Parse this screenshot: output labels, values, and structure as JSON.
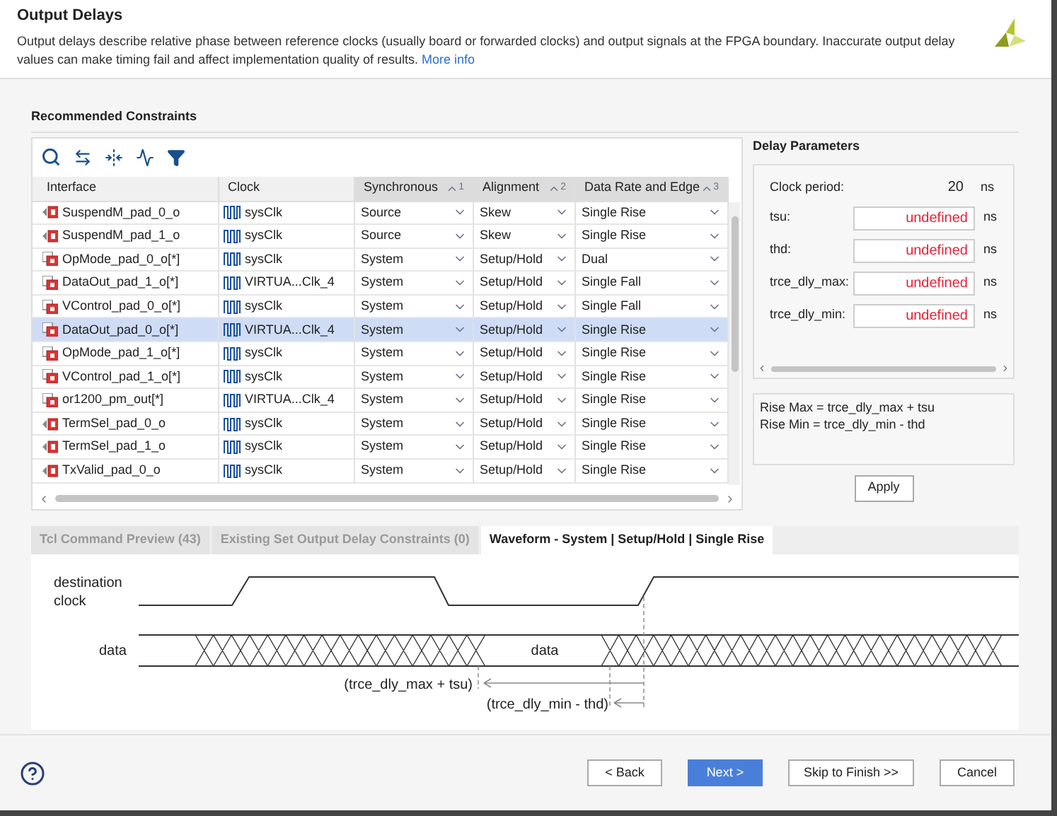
{
  "header": {
    "title": "Output Delays",
    "description": "Output delays describe relative phase between reference clocks (usually board or forwarded clocks) and output signals at the FPGA boundary. Inaccurate output delay values can make timing fail and affect implementation quality of results.",
    "link": "More info"
  },
  "constraints": {
    "title": "Recommended Constraints",
    "columns": [
      {
        "label": "Interface",
        "sorted": false
      },
      {
        "label": "Clock",
        "sorted": false
      },
      {
        "label": "Synchronous",
        "sorted": true,
        "sort_order": "1"
      },
      {
        "label": "Alignment",
        "sorted": true,
        "sort_order": "2"
      },
      {
        "label": "Data Rate and Edge",
        "sorted": true,
        "sort_order": "3"
      }
    ],
    "rows": [
      {
        "interface": "SuspendM_pad_0_o",
        "kind": "port",
        "clock": "sysClk",
        "synchronous": "Source",
        "alignment": "Skew",
        "data_rate": "Single Rise",
        "selected": false
      },
      {
        "interface": "SuspendM_pad_1_o",
        "kind": "port",
        "clock": "sysClk",
        "synchronous": "Source",
        "alignment": "Skew",
        "data_rate": "Single Rise",
        "selected": false
      },
      {
        "interface": "OpMode_pad_0_o[*]",
        "kind": "bus",
        "clock": "sysClk",
        "synchronous": "System",
        "alignment": "Setup/Hold",
        "data_rate": "Dual",
        "selected": false
      },
      {
        "interface": "DataOut_pad_1_o[*]",
        "kind": "bus",
        "clock": "VIRTUA...Clk_4",
        "synchronous": "System",
        "alignment": "Setup/Hold",
        "data_rate": "Single Fall",
        "selected": false
      },
      {
        "interface": "VControl_pad_0_o[*]",
        "kind": "bus",
        "clock": "sysClk",
        "synchronous": "System",
        "alignment": "Setup/Hold",
        "data_rate": "Single Fall",
        "selected": false
      },
      {
        "interface": "DataOut_pad_0_o[*]",
        "kind": "bus",
        "clock": "VIRTUA...Clk_4",
        "synchronous": "System",
        "alignment": "Setup/Hold",
        "data_rate": "Single Rise",
        "selected": true
      },
      {
        "interface": "OpMode_pad_1_o[*]",
        "kind": "bus",
        "clock": "sysClk",
        "synchronous": "System",
        "alignment": "Setup/Hold",
        "data_rate": "Single Rise",
        "selected": false
      },
      {
        "interface": "VControl_pad_1_o[*]",
        "kind": "bus",
        "clock": "sysClk",
        "synchronous": "System",
        "alignment": "Setup/Hold",
        "data_rate": "Single Rise",
        "selected": false
      },
      {
        "interface": "or1200_pm_out[*]",
        "kind": "bus",
        "clock": "VIRTUA...Clk_4",
        "synchronous": "System",
        "alignment": "Setup/Hold",
        "data_rate": "Single Rise",
        "selected": false
      },
      {
        "interface": "TermSel_pad_0_o",
        "kind": "port",
        "clock": "sysClk",
        "synchronous": "System",
        "alignment": "Setup/Hold",
        "data_rate": "Single Rise",
        "selected": false
      },
      {
        "interface": "TermSel_pad_1_o",
        "kind": "port",
        "clock": "sysClk",
        "synchronous": "System",
        "alignment": "Setup/Hold",
        "data_rate": "Single Rise",
        "selected": false
      },
      {
        "interface": "TxValid_pad_0_o",
        "kind": "port",
        "clock": "sysClk",
        "synchronous": "System",
        "alignment": "Setup/Hold",
        "data_rate": "Single Rise",
        "selected": false
      }
    ]
  },
  "delay_parameters": {
    "title": "Delay Parameters",
    "clock_period": {
      "label": "Clock period:",
      "value": "20",
      "unit": "ns"
    },
    "fields": [
      {
        "label": "tsu:",
        "value": "undefined",
        "unit": "ns"
      },
      {
        "label": "thd:",
        "value": "undefined",
        "unit": "ns"
      },
      {
        "label": "trce_dly_max:",
        "value": "undefined",
        "unit": "ns"
      },
      {
        "label": "trce_dly_min:",
        "value": "undefined",
        "unit": "ns"
      }
    ],
    "formulas": [
      "Rise Max = trce_dly_max + tsu",
      "Rise Min = trce_dly_min - thd"
    ],
    "apply": "Apply"
  },
  "bottom_tabs": [
    {
      "label": "Tcl Command Preview (43)",
      "selected": false
    },
    {
      "label": "Existing Set Output Delay Constraints (0)",
      "selected": false
    },
    {
      "label": "Waveform - System | Setup/Hold | Single Rise",
      "selected": true
    }
  ],
  "waveform": {
    "clock_label": "destination clock",
    "data_label": "data",
    "data_window_label": "data",
    "max_label": "(trce_dly_max + tsu)",
    "min_label": "(trce_dly_min - thd)"
  },
  "footer": {
    "buttons": [
      {
        "label": "< Back",
        "kind": "normal"
      },
      {
        "label": "Next >",
        "kind": "primary"
      },
      {
        "label": "Skip to Finish >>",
        "kind": "normal"
      },
      {
        "label": "Cancel",
        "kind": "normal"
      }
    ]
  }
}
